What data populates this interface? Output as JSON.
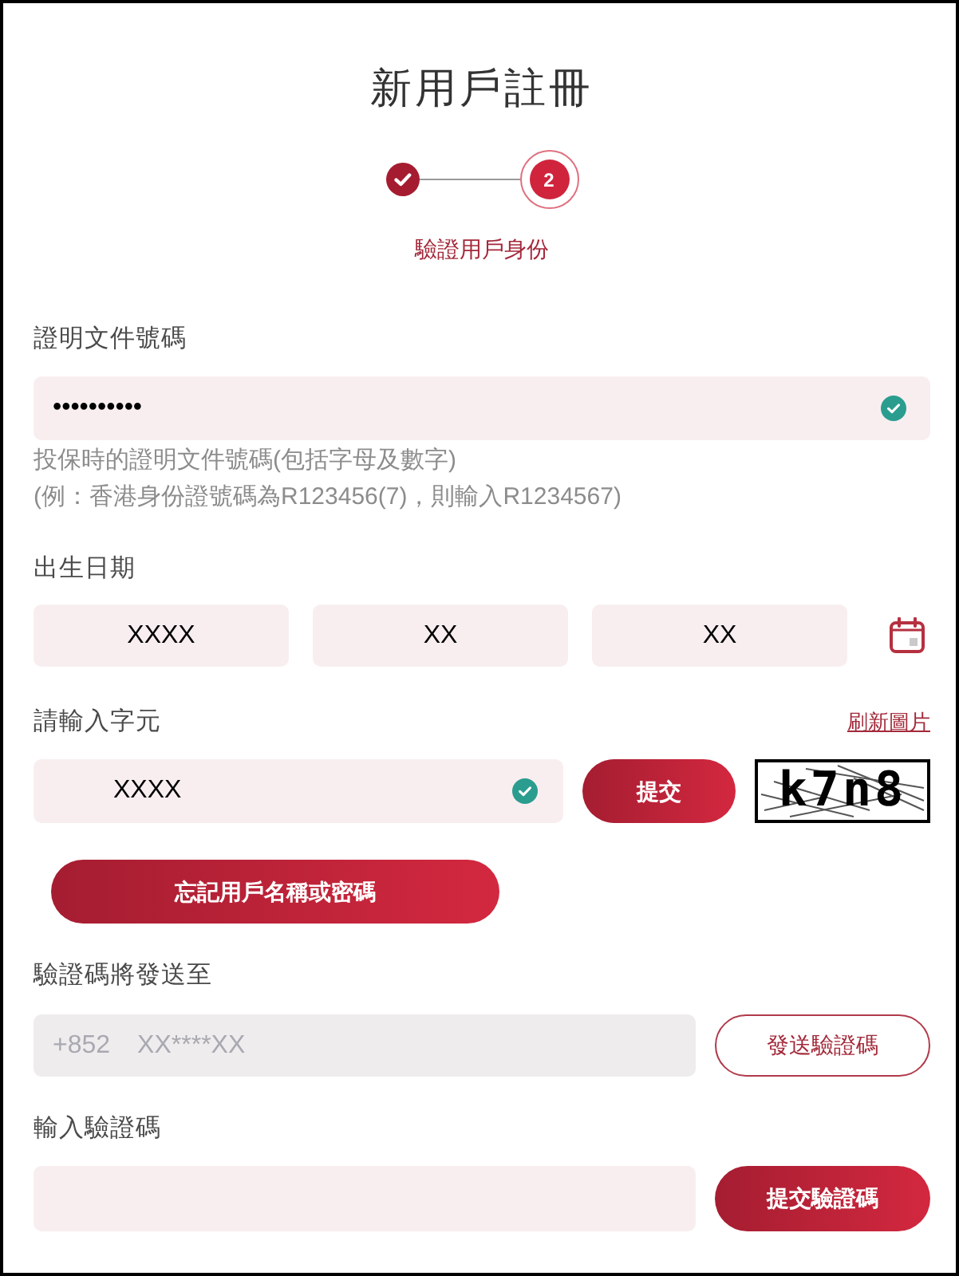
{
  "title": "新用戶註冊",
  "stepper": {
    "steps": [
      {
        "kind": "done"
      },
      {
        "kind": "current",
        "number": "2"
      }
    ],
    "caption": "驗證用戶身份"
  },
  "id_number": {
    "label": "證明文件號碼",
    "value": "••••••••••",
    "valid": true,
    "hints": [
      "投保時的證明文件號碼(包括字母及數字)",
      "(例：香港身份證號碼為R123456(7)，則輸入R1234567)"
    ]
  },
  "birth_date": {
    "label": "出生日期",
    "fields": [
      {
        "value": "XXXX"
      },
      {
        "value": "XX"
      },
      {
        "value": "XX"
      }
    ]
  },
  "captcha": {
    "label": "請輸入字元",
    "refresh_link": "刷新圖片",
    "value": "XXXX",
    "valid": true,
    "submit_button": "提交",
    "image_text": "k7n8"
  },
  "forgot_button": "忘記用戶名稱或密碼",
  "send_to": {
    "label": "驗證碼將發送至",
    "country_code": "+852",
    "value": "XX****XX",
    "disabled": true,
    "button": "發送驗證碼"
  },
  "verification": {
    "label": "輸入驗證碼",
    "button": "提交驗證碼"
  }
}
